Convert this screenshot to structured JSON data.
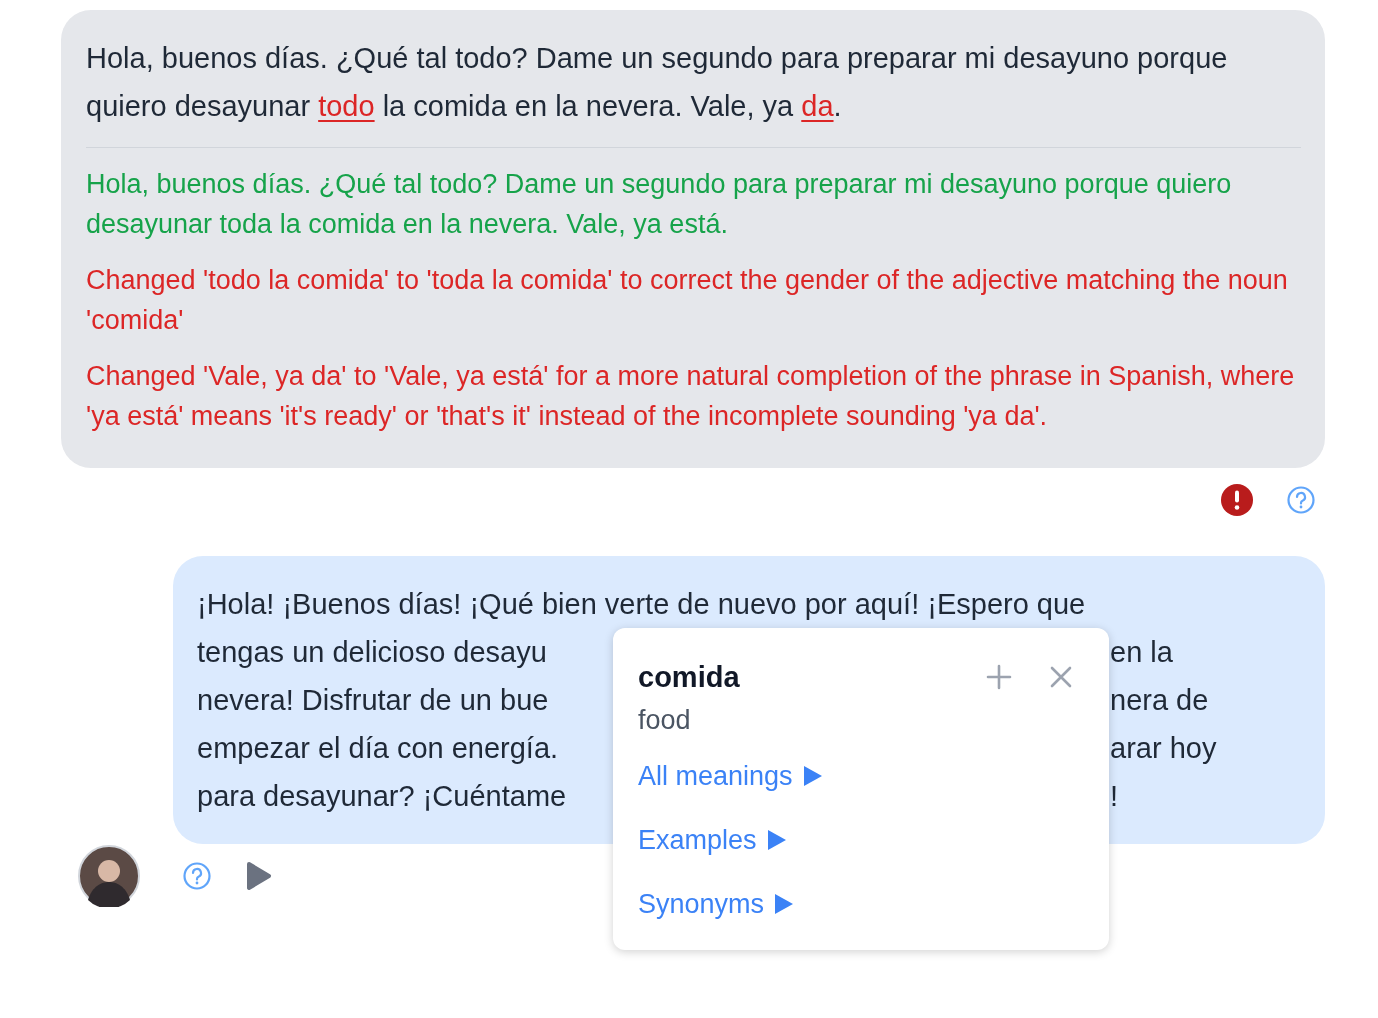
{
  "user_message": {
    "segments": [
      {
        "text": "Hola, buenos días. ¿Qué tal todo? Dame un segundo para preparar mi desayuno porque quiero desayunar ",
        "kind": "plain"
      },
      {
        "text": "todo",
        "kind": "error"
      },
      {
        "text": " la comida en la nevera. Vale, ya ",
        "kind": "plain"
      },
      {
        "text": "da",
        "kind": "error"
      },
      {
        "text": ".",
        "kind": "plain"
      }
    ],
    "feedback": [
      {
        "kind": "corrected",
        "text": "Hola, buenos días. ¿Qué tal todo? Dame un segundo para preparar mi desayuno porque quiero desayunar toda la comida en la nevera. Vale, ya está."
      },
      {
        "kind": "explanation",
        "text": "Changed 'todo la comida' to 'toda la comida' to correct the gender of the adjective matching the noun 'comida'"
      },
      {
        "kind": "explanation",
        "text": "Changed 'Vale, ya da' to 'Vale, ya está' for a more natural completion of the phrase in Spanish, where 'ya está' means 'it's ready' or 'that's it' instead of the incomplete sounding 'ya da'."
      }
    ],
    "has_errors": true
  },
  "reply_message": {
    "lines": [
      {
        "start": "¡Hola! ¡Buenos días! ¡Qué bien verte de nuevo por aquí! ¡Espero que"
      },
      {
        "start": "tengas un delicioso desayu",
        "end": "en la"
      },
      {
        "start": "nevera! Disfrutar de un bue",
        "end": "nera de"
      },
      {
        "start": "empezar el día con energía.",
        "end": "arar hoy"
      },
      {
        "start": "para desayunar? ¡Cuéntame",
        "end": "!"
      }
    ]
  },
  "word_popup": {
    "word": "comida",
    "translation": "food",
    "links": [
      "All meanings",
      "Examples",
      "Synonyms"
    ]
  }
}
